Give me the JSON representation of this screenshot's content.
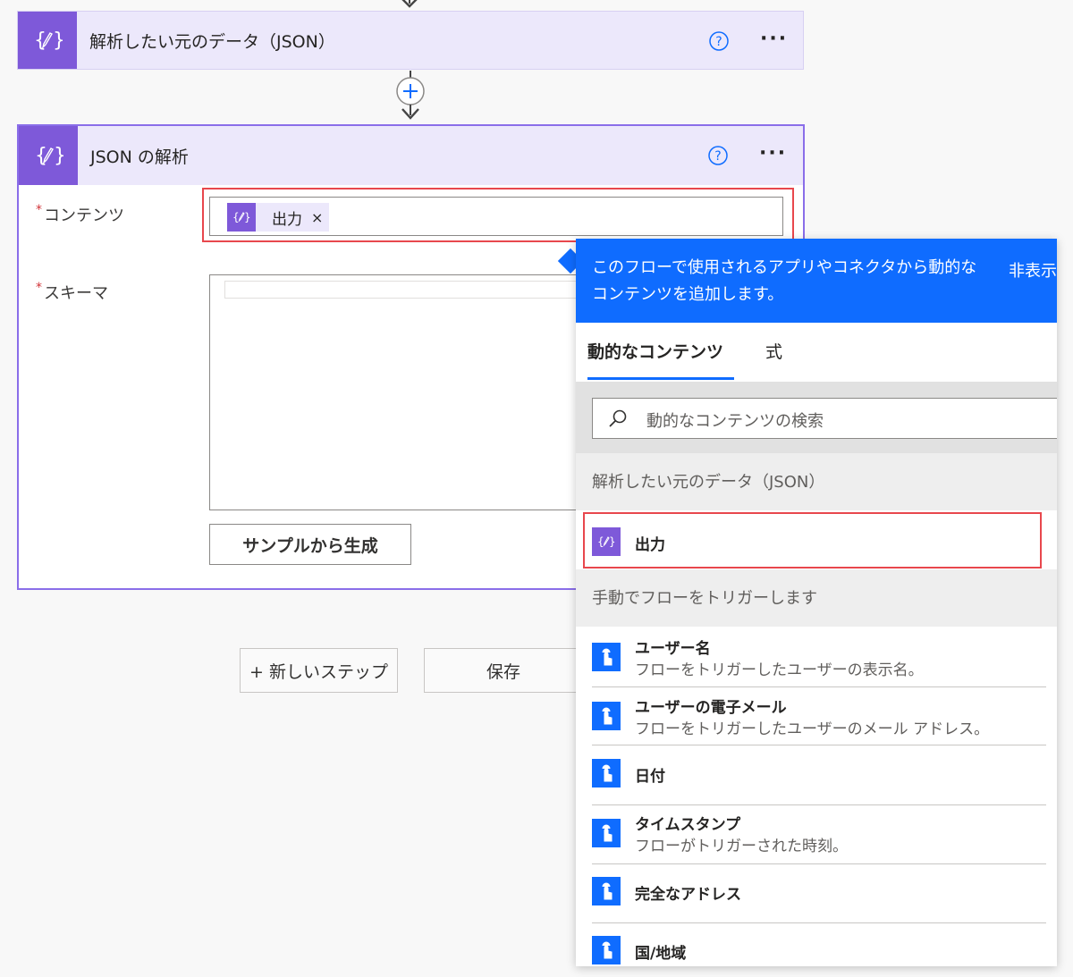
{
  "flow": {
    "step1": {
      "title": "解析したい元のデータ（JSON）",
      "help_icon": "question-circle-icon",
      "more_label": "···"
    },
    "step2": {
      "title": "JSON の解析",
      "more_label": "···",
      "content_label": "コンテンツ",
      "schema_label": "スキーマ",
      "required_mark": "*",
      "token_label": "出力",
      "token_remove": "×",
      "sample_button": "サンプルから生成"
    },
    "new_step_button": "+ 新しいステップ",
    "save_button": "保存"
  },
  "panel": {
    "description": "このフローで使用されるアプリやコネクタから動的なコンテンツを追加します。",
    "hide_label": "非表示",
    "tabs": [
      "動的なコンテンツ",
      "式"
    ],
    "search_placeholder": "動的なコンテンツの検索",
    "sections": [
      {
        "title": "解析したい元のデータ（JSON）",
        "items": [
          {
            "title": "出力"
          }
        ]
      },
      {
        "title": "手動でフローをトリガーします",
        "items": [
          {
            "title": "ユーザー名",
            "desc": "フローをトリガーしたユーザーの表示名。"
          },
          {
            "title": "ユーザーの電子メール",
            "desc": "フローをトリガーしたユーザーのメール アドレス。"
          },
          {
            "title": "日付"
          },
          {
            "title": "タイムスタンプ",
            "desc": "フローがトリガーされた時刻。"
          },
          {
            "title": "完全なアドレス"
          },
          {
            "title": "国/地域"
          }
        ]
      }
    ]
  },
  "colors": {
    "accent_purple": "#7e59d9",
    "accent_blue": "#0f6cff",
    "highlight_red": "#e8474d"
  }
}
